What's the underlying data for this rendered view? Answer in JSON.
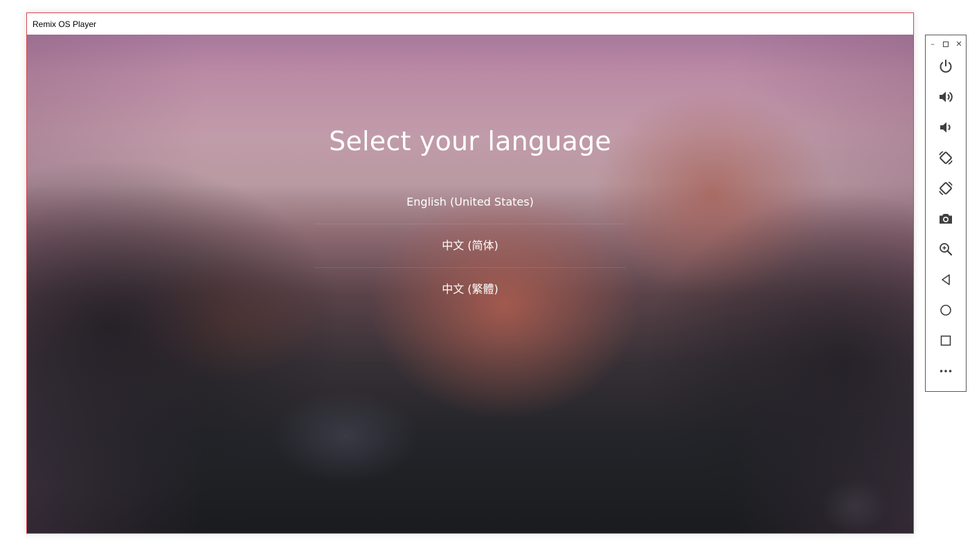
{
  "window": {
    "title": "Remix OS Player"
  },
  "setup": {
    "heading": "Select your language",
    "languages": [
      "English (United States)",
      "中文 (简体)",
      "中文 (繁體)"
    ]
  },
  "toolbar": {
    "window_controls": [
      "minimize-icon",
      "maximize-icon",
      "close-icon"
    ],
    "buttons": [
      "power-icon",
      "volume-up-icon",
      "volume-down-icon",
      "rotate-left-icon",
      "rotate-right-icon",
      "screenshot-camera-icon",
      "zoom-icon",
      "back-icon",
      "home-icon",
      "recents-icon",
      "more-icon"
    ]
  },
  "colors": {
    "window_border": "#d9434f",
    "toolbar_icon": "#3f3f3f",
    "text": "#ffffff"
  }
}
